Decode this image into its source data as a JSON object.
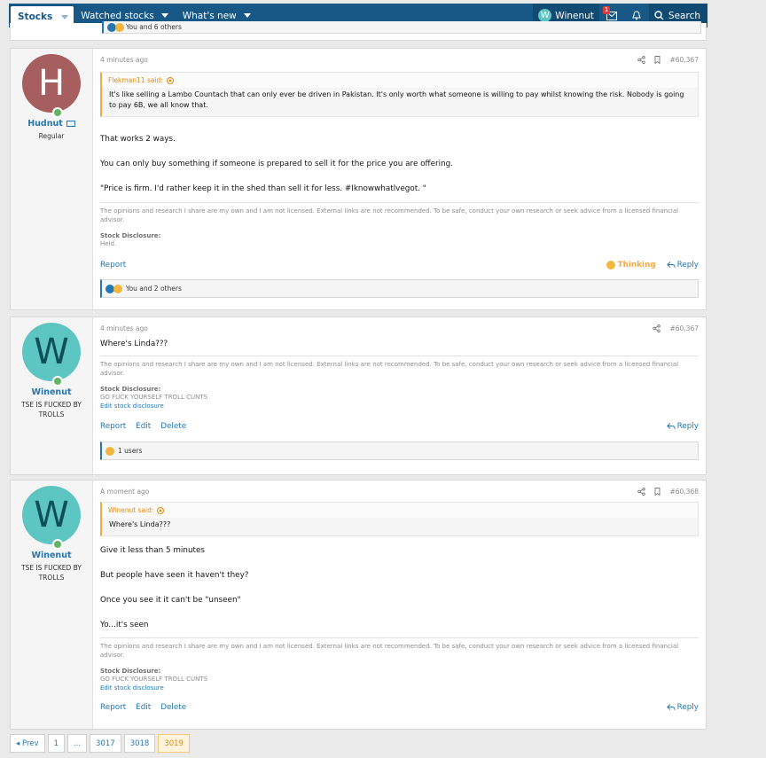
{
  "nav": {
    "tabs": [
      {
        "label": "Stocks"
      },
      {
        "label": "Watched stocks"
      },
      {
        "label": "What's new"
      }
    ],
    "user": {
      "initial": "W",
      "name": "Winenut"
    },
    "alerts_badge": "1",
    "search_label": "Search"
  },
  "top_reactions": {
    "text": "You and 6 others"
  },
  "colors": {
    "nav_bg": "#185886",
    "link": "#2577b1",
    "quote_accent": "#e08a0c",
    "avatar_h": "#a65e5e",
    "avatar_w": "#5dc6c2",
    "online": "#63b265"
  },
  "posts": [
    {
      "avatar_initial": "H",
      "username": "Hudnut",
      "user_title": "Regular",
      "time": "4 minutes ago",
      "post_number": "#60,367",
      "quote": {
        "author": "Flekman11 said:",
        "text": "It's like selling a Lambo Countach that can only ever be driven in Pakistan. It's only worth what someone is willing to pay whilst knowing the risk. Nobody is going to pay 6B, we all know that."
      },
      "paragraphs": [
        "That works 2 ways.",
        "You can only buy something if someone is prepared to sell it for the price you are offering.",
        "\"Price is firm. I'd rather keep it in the shed than sell it for less. #Iknowwhatlvegot. \""
      ],
      "signature": "The opinions and research I share are my own and I am not licensed. External links are not recommended. To be safe, conduct your own research or seek advice from a licensed financial advisor.",
      "disclosure_label": "Stock Disclosure:",
      "disclosure_text": "Held.",
      "actions": {
        "report": "Report",
        "thinking": "Thinking",
        "reply": "Reply"
      },
      "reactions": "You and 2 others"
    },
    {
      "avatar_initial": "W",
      "username": "Winenut",
      "user_title": "TSE IS FUCKED BY TROLLS",
      "time": "4 minutes ago",
      "post_number": "#60,367",
      "paragraphs": [
        "Where's Linda???"
      ],
      "signature": "The opinions and research I share are my own and I am not licensed. External links are not recommended. To be safe, conduct your own research or seek advice from a licensed financial advisor.",
      "disclosure_label": "Stock Disclosure:",
      "disclosure_text": "GO FUCK YOURSELF TROLL CUNTS",
      "edit_disclosure": "Edit stock disclosure",
      "actions": {
        "report": "Report",
        "edit": "Edit",
        "delete": "Delete",
        "reply": "Reply"
      },
      "reactions": "1 users"
    },
    {
      "avatar_initial": "W",
      "username": "Winenut",
      "user_title": "TSE IS FUCKED BY TROLLS",
      "time": "A moment ago",
      "post_number": "#60,368",
      "quote": {
        "author": "Winenut said:",
        "text": "Where's Linda???"
      },
      "paragraphs": [
        "Give it less than 5 minutes",
        "But people have seen it haven't they?",
        "Once you see it it can't be \"unseen\"",
        "Yo...it's seen"
      ],
      "signature": "The opinions and research I share are my own and I am not licensed. External links are not recommended. To be safe, conduct your own research or seek advice from a licensed financial advisor.",
      "disclosure_label": "Stock Disclosure:",
      "disclosure_text": "GO FUCK YOURSELF TROLL CUNTS",
      "edit_disclosure": "Edit stock disclosure",
      "actions": {
        "report": "Report",
        "edit": "Edit",
        "delete": "Delete",
        "reply": "Reply"
      }
    }
  ],
  "pagination": {
    "prev": "◂ Prev",
    "pages": [
      "1",
      "...",
      "3017",
      "3018",
      "3019"
    ],
    "current": "3019"
  }
}
